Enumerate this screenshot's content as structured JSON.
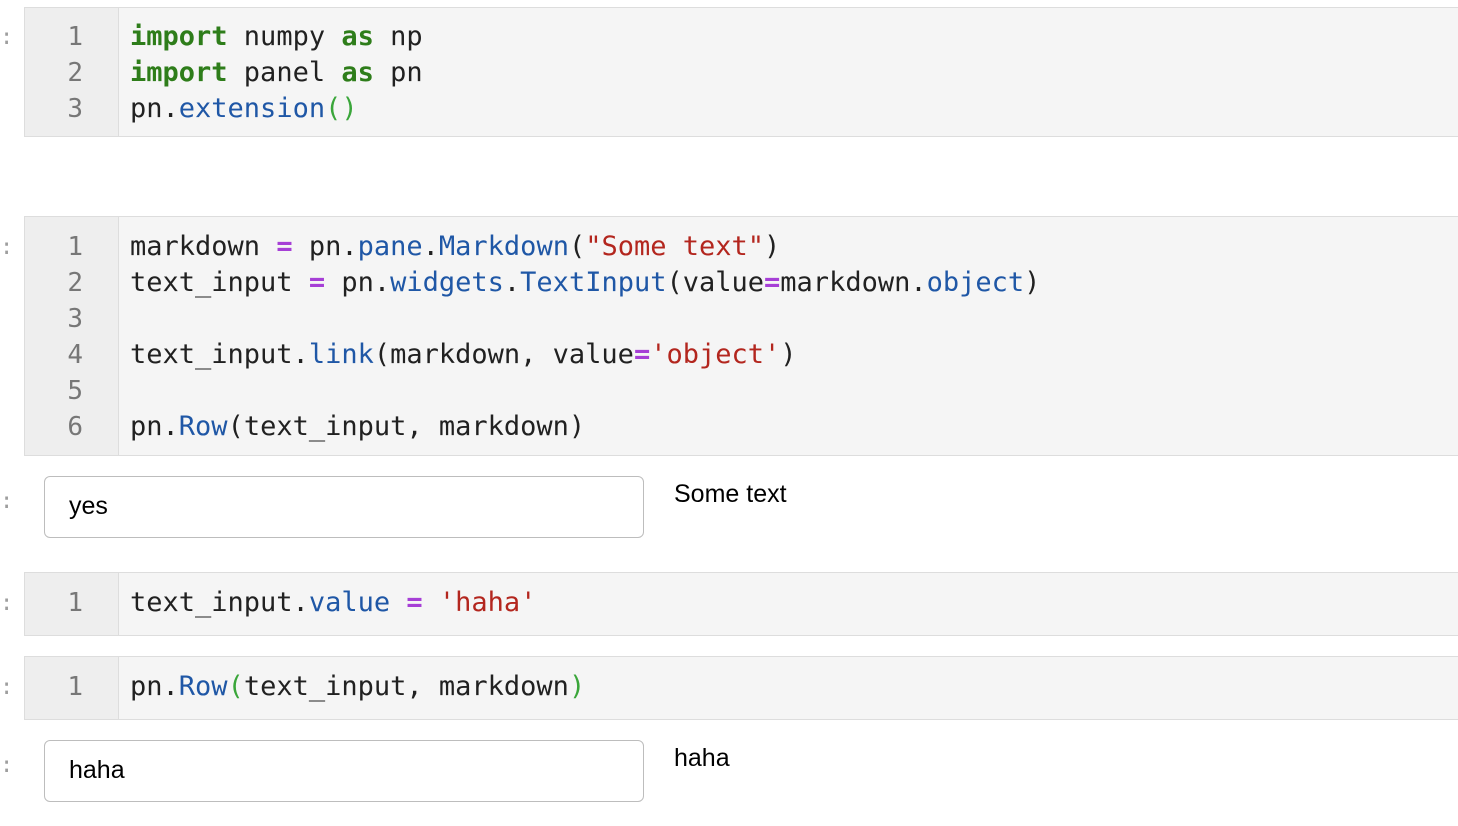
{
  "prompt_glyph": ":",
  "cells": [
    {
      "line_numbers": [
        "1",
        "2",
        "3"
      ],
      "lines": [
        [
          {
            "t": "import",
            "c": "kw"
          },
          {
            "t": " numpy ",
            "c": ""
          },
          {
            "t": "as",
            "c": "kw"
          },
          {
            "t": " np",
            "c": ""
          }
        ],
        [
          {
            "t": "import",
            "c": "kw"
          },
          {
            "t": " panel ",
            "c": ""
          },
          {
            "t": "as",
            "c": "kw"
          },
          {
            "t": " pn",
            "c": ""
          }
        ],
        [
          {
            "t": "pn.",
            "c": ""
          },
          {
            "t": "extension",
            "c": "fn"
          },
          {
            "t": "()",
            "c": "br"
          }
        ]
      ]
    },
    {
      "line_numbers": [
        "1",
        "2",
        "3",
        "4",
        "5",
        "6"
      ],
      "lines": [
        [
          {
            "t": "markdown ",
            "c": ""
          },
          {
            "t": "=",
            "c": "op"
          },
          {
            "t": " pn.",
            "c": ""
          },
          {
            "t": "pane",
            "c": "fn"
          },
          {
            "t": ".",
            "c": ""
          },
          {
            "t": "Markdown",
            "c": "fn"
          },
          {
            "t": "(",
            "c": ""
          },
          {
            "t": "\"Some text\"",
            "c": "str"
          },
          {
            "t": ")",
            "c": ""
          }
        ],
        [
          {
            "t": "text_input ",
            "c": ""
          },
          {
            "t": "=",
            "c": "op"
          },
          {
            "t": " pn.",
            "c": ""
          },
          {
            "t": "widgets",
            "c": "fn"
          },
          {
            "t": ".",
            "c": ""
          },
          {
            "t": "TextInput",
            "c": "fn"
          },
          {
            "t": "(value",
            "c": ""
          },
          {
            "t": "=",
            "c": "op"
          },
          {
            "t": "markdown.",
            "c": ""
          },
          {
            "t": "object",
            "c": "fn"
          },
          {
            "t": ")",
            "c": ""
          }
        ],
        [],
        [
          {
            "t": "text_input.",
            "c": ""
          },
          {
            "t": "link",
            "c": "fn"
          },
          {
            "t": "(markdown, value",
            "c": ""
          },
          {
            "t": "=",
            "c": "op"
          },
          {
            "t": "'object'",
            "c": "str"
          },
          {
            "t": ")",
            "c": ""
          }
        ],
        [],
        [
          {
            "t": "pn.",
            "c": ""
          },
          {
            "t": "Row",
            "c": "fn"
          },
          {
            "t": "(text_input, markdown)",
            "c": ""
          }
        ]
      ]
    },
    {
      "line_numbers": [
        "1"
      ],
      "lines": [
        [
          {
            "t": "text_input.",
            "c": ""
          },
          {
            "t": "value",
            "c": "fn"
          },
          {
            "t": " ",
            "c": ""
          },
          {
            "t": "=",
            "c": "op"
          },
          {
            "t": " ",
            "c": ""
          },
          {
            "t": "'haha'",
            "c": "str"
          }
        ]
      ]
    },
    {
      "line_numbers": [
        "1"
      ],
      "lines": [
        [
          {
            "t": "pn.",
            "c": ""
          },
          {
            "t": "Row",
            "c": "fn"
          },
          {
            "t": "(",
            "c": "br"
          },
          {
            "t": "text_input, markdown",
            "c": ""
          },
          {
            "t": ")",
            "c": "br"
          }
        ]
      ]
    }
  ],
  "outputs": [
    {
      "input_value": "yes",
      "markdown_text": "Some text"
    },
    {
      "input_value": "haha",
      "markdown_text": "haha"
    }
  ]
}
